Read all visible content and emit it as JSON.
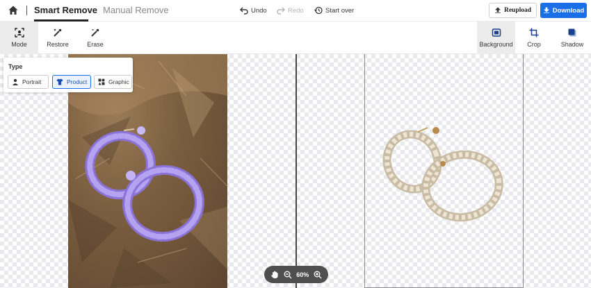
{
  "header": {
    "tab_smart": "Smart Remove",
    "tab_manual": "Manual Remove",
    "undo": "Undo",
    "redo": "Redo",
    "start_over": "Start over",
    "reupload": "Reupload",
    "download": "Download"
  },
  "toolbar": {
    "mode": "Mode",
    "restore": "Restore",
    "erase": "Erase",
    "background": "Background",
    "crop": "Crop",
    "shadow": "Shadow"
  },
  "mode_popup": {
    "title": "Type",
    "options": [
      "Portrait",
      "Product",
      "Graphic"
    ],
    "selected": "Product"
  },
  "zoom": {
    "level": "60%"
  },
  "colors": {
    "accent": "#1a6fe8",
    "bead_purple": "#a38ee8",
    "bead_cream": "#e8dcc8"
  }
}
